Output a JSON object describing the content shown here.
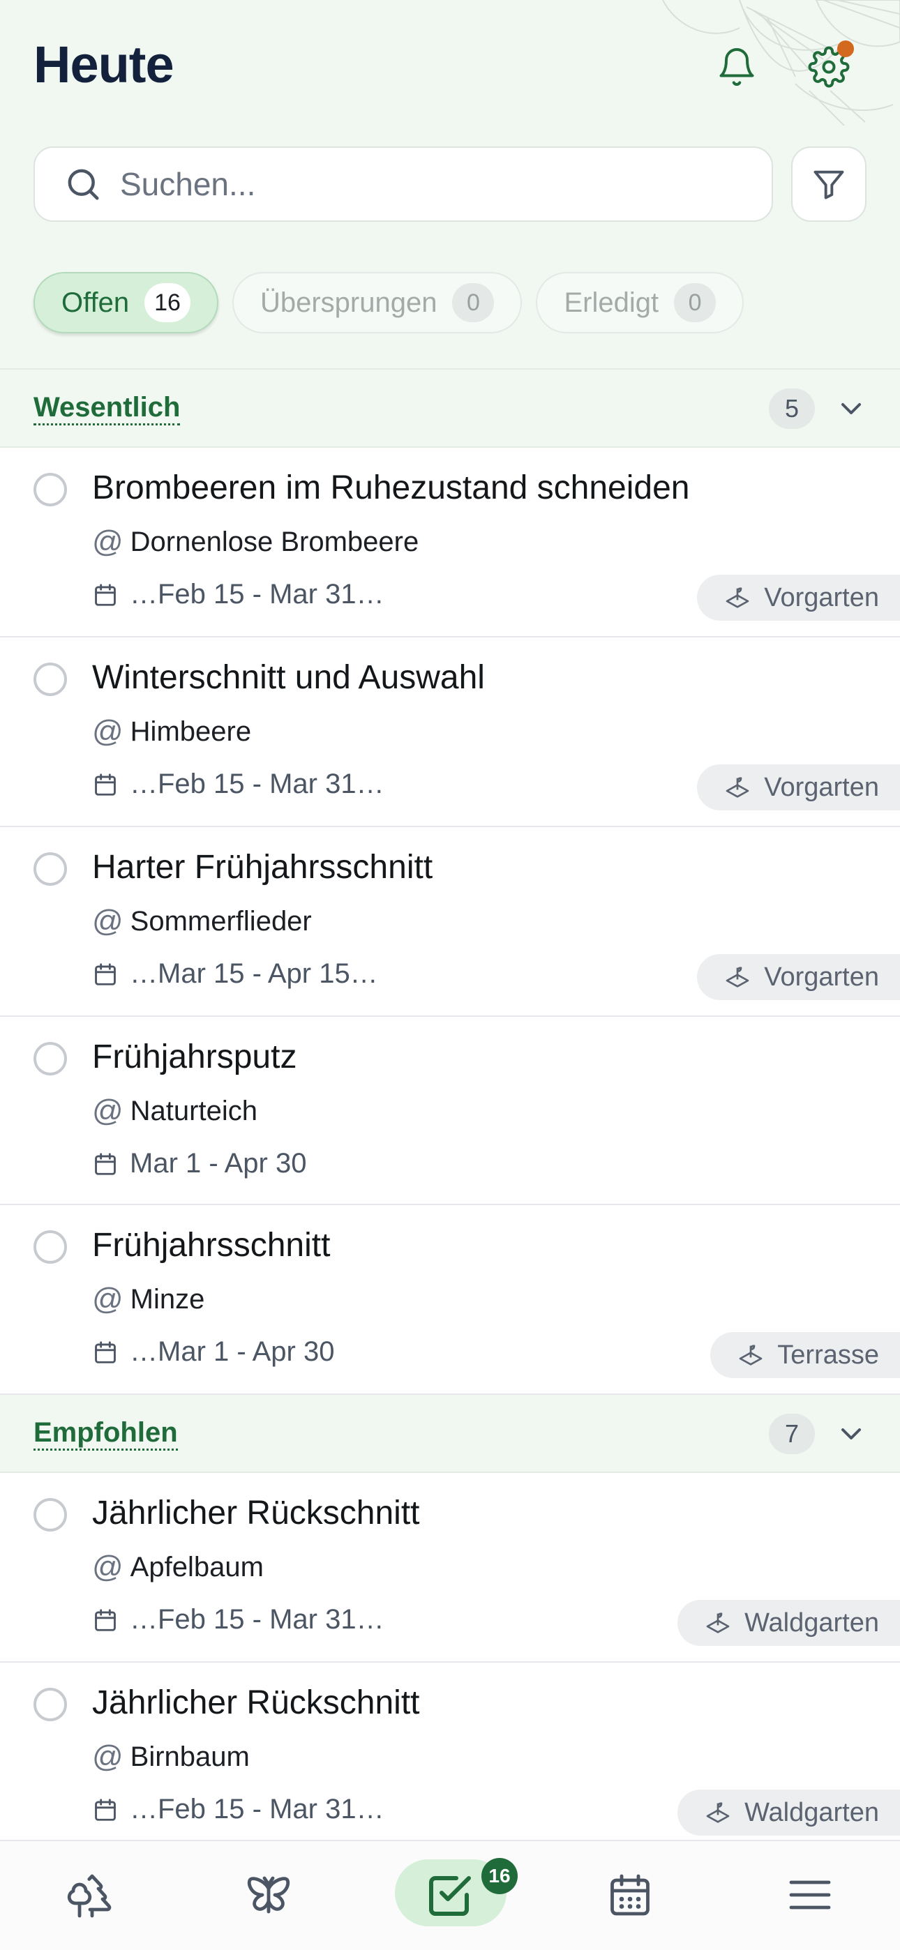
{
  "header": {
    "title": "Heute"
  },
  "search": {
    "placeholder": "Suchen..."
  },
  "tabs": [
    {
      "label": "Offen",
      "count": "16",
      "active": true
    },
    {
      "label": "Übersprungen",
      "count": "0",
      "active": false
    },
    {
      "label": "Erledigt",
      "count": "0",
      "active": false
    }
  ],
  "sections": [
    {
      "title": "Wesentlich",
      "count": "5",
      "tasks": [
        {
          "title": "Brombeeren im Ruhezustand schneiden",
          "plant": "Dornenlose Brombeere",
          "date": "…Feb 15 - Mar 31…",
          "location": "Vorgarten"
        },
        {
          "title": "Winterschnitt und Auswahl",
          "plant": "Himbeere",
          "date": "…Feb 15 - Mar 31…",
          "location": "Vorgarten"
        },
        {
          "title": "Harter Frühjahrsschnitt",
          "plant": "Sommerflieder",
          "date": "…Mar 15 - Apr 15…",
          "location": "Vorgarten"
        },
        {
          "title": "Frühjahrsputz",
          "plant": "Naturteich",
          "date": "Mar 1 - Apr 30",
          "location": ""
        },
        {
          "title": "Frühjahrsschnitt",
          "plant": "Minze",
          "date": "…Mar 1 - Apr 30",
          "location": "Terrasse"
        }
      ]
    },
    {
      "title": "Empfohlen",
      "count": "7",
      "tasks": [
        {
          "title": "Jährlicher Rückschnitt",
          "plant": "Apfelbaum",
          "date": "…Feb 15 - Mar 31…",
          "location": "Waldgarten"
        },
        {
          "title": "Jährlicher Rückschnitt",
          "plant": "Birnbaum",
          "date": "…Feb 15 - Mar 31…",
          "location": "Waldgarten"
        }
      ]
    }
  ],
  "nav": {
    "tasks_badge": "16"
  },
  "colors": {
    "accent": "#1f6b3a",
    "header_bg": "#f1f8f1",
    "active_pill": "#d5efd9",
    "notification_dot": "#d2691e"
  }
}
